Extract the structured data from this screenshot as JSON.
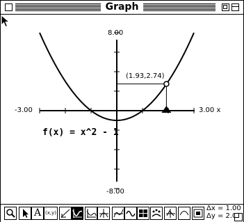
{
  "window": {
    "title": "Graph"
  },
  "graph": {
    "y_max_label": "8.00",
    "y_min_label": "-8.00",
    "x_min_label": "-3.00",
    "x_max_label": "3.00",
    "x_axis_name": "x",
    "function_label": "f(x) = x^2 - 1",
    "trace_point_label": "(1.93,2.74)"
  },
  "chart_data": {
    "type": "line",
    "title": "",
    "function": "f(x) = x^2 - 1",
    "xlim": [
      -3.0,
      3.0
    ],
    "ylim": [
      -8.0,
      8.0
    ],
    "x": [
      -2.9,
      -2.5,
      -2.0,
      -1.5,
      -1.0,
      -0.5,
      0.0,
      0.5,
      1.0,
      1.5,
      2.0,
      2.5,
      2.9
    ],
    "series": [
      {
        "values": [
          7.41,
          5.25,
          3.0,
          1.25,
          0.0,
          -0.75,
          -1.0,
          -0.75,
          0.0,
          1.25,
          3.0,
          5.25,
          7.41
        ]
      }
    ],
    "trace_point": {
      "x": 1.93,
      "y": 2.74
    },
    "grid": false
  },
  "toolbar": {
    "tools": [
      {
        "name": "zoom-icon",
        "glyph": ""
      },
      {
        "name": "arrow-pointer-icon",
        "glyph": ""
      },
      {
        "name": "text-tool-icon",
        "glyph": "A"
      },
      {
        "name": "coordinate-readout-icon",
        "glyph": "(x,y)"
      },
      {
        "name": "tangent-line-icon",
        "glyph": ""
      },
      {
        "name": "derivative-curve-icon",
        "glyph": ""
      },
      {
        "name": "slope-field-icon",
        "glyph": ""
      },
      {
        "name": "perpendicular-icon",
        "glyph": ""
      },
      {
        "name": "inflection-icon",
        "glyph": ""
      },
      {
        "name": "wave-icon",
        "glyph": ""
      },
      {
        "name": "split-grid-icon",
        "glyph": ""
      },
      {
        "name": "dotted-curve-icon",
        "glyph": ""
      },
      {
        "name": "rotate-icon",
        "glyph": ""
      },
      {
        "name": "smooth-curve-icon",
        "glyph": ""
      },
      {
        "name": "window-layout-icon",
        "glyph": ""
      }
    ],
    "delta_x": "Δx = 1.00",
    "delta_y": "Δy = 2.00"
  }
}
